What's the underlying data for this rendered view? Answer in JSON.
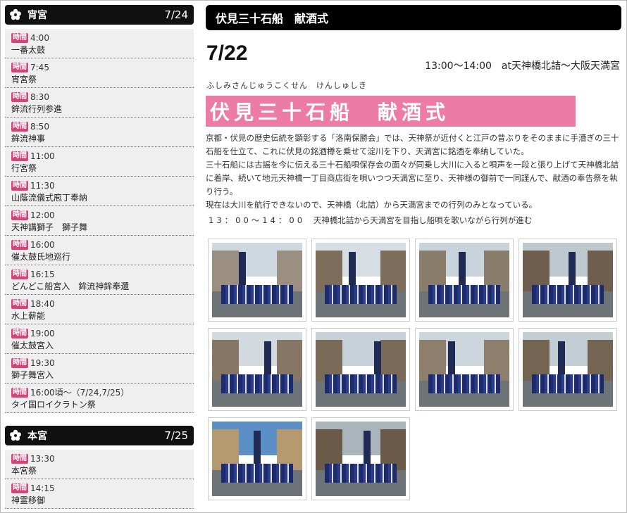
{
  "badge_label": "時間",
  "sidebar": {
    "day1": {
      "title": "宵宮",
      "date": "7/24",
      "items": [
        {
          "time": "4:00",
          "event": "一番太鼓"
        },
        {
          "time": "7:45",
          "event": "宵宮祭"
        },
        {
          "time": "8:30",
          "event": "鉾流行列参進"
        },
        {
          "time": "8:50",
          "event": "鉾流神事"
        },
        {
          "time": "11:00",
          "event": "行宮祭"
        },
        {
          "time": "11:30",
          "event": "山蔭流儀式庖丁奉納"
        },
        {
          "time": "12:00",
          "event": "天神講獅子　獅子舞"
        },
        {
          "time": "16:00",
          "event": "催太鼓氏地巡行"
        },
        {
          "time": "16:15",
          "event": "どんどこ船宮入　鉾流神鉾奉還"
        },
        {
          "time": "18:40",
          "event": "水上薪能"
        },
        {
          "time": "19:00",
          "event": "催太鼓宮入"
        },
        {
          "time": "19:30",
          "event": "獅子舞宮入"
        },
        {
          "time": "16:00頃～（7/24,7/25）",
          "event": "タイ国ロイクラトン祭"
        }
      ]
    },
    "day2": {
      "title": "本宮",
      "date": "7/25",
      "items": [
        {
          "time": "13:30",
          "event": "本宮祭"
        },
        {
          "time": "14:15",
          "event": "神霊移御"
        }
      ]
    }
  },
  "main": {
    "title": "伏見三十石船　献酒式",
    "date": "7/22",
    "time_place": "13:00～14:00　at天神橋北詰～大阪天満宮",
    "reading": "ふしみさんじゅうこくせん　けんしゅしき",
    "banner": "伏見三十石船　献酒式",
    "desc1": "京都・伏見の歴史伝統を顕彰する「洛南保勝会」では、天神祭が近付くと江戸の昔ぶりをそのままに手漕ぎの三十石船を仕立て、これに伏見の銘酒樽を乗せて淀川を下り、天満宮に銘酒を奉納していた。",
    "desc2": "三十石船には古謡を今に伝える三十石船唄保存会の面々が同乗し大川に入ると唄声を一段と張り上げて天神橋北詰に着岸、続いて地元天神橋一丁目商店街を唄いつつ天満宮に至り、天神様の御前で一同謹んで、献酒の奉告祭を執り行う。",
    "desc3": "現在は大川を航行できないので、天神橋（北詰）から天満宮までの行列のみとなっている。",
    "route_time": "13：00～14：00",
    "route_text": "天神橋北詰から天満宮を目指し船唄を歌いながら行列が進む",
    "colors": {
      "banner": "#ec7ca5",
      "badge": "#d9437c",
      "header": "#000000"
    }
  }
}
